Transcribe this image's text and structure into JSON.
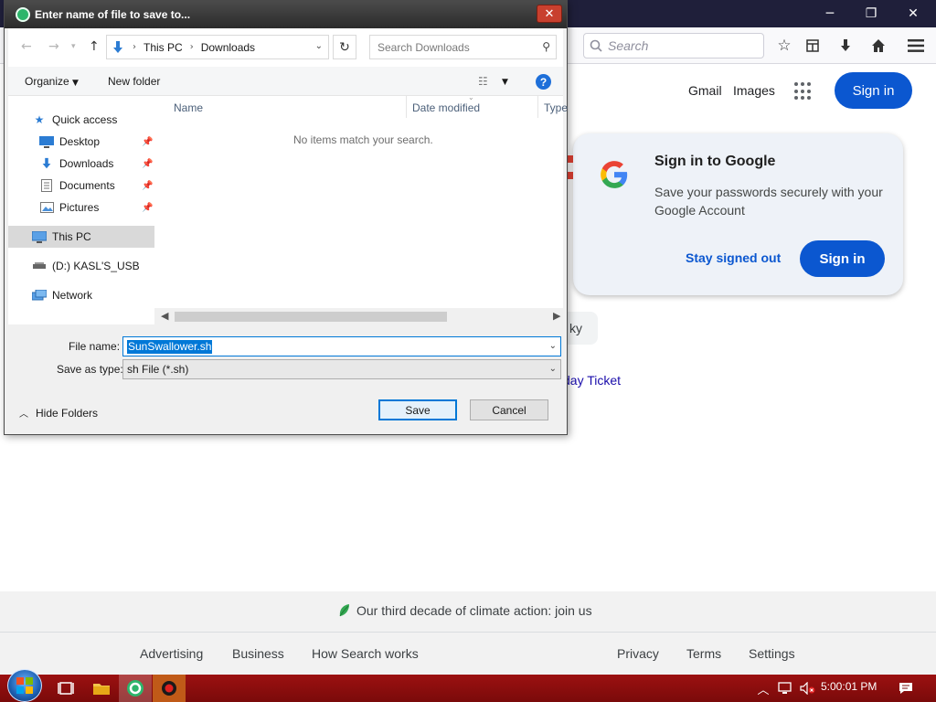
{
  "browser": {
    "search_placeholder": "Search",
    "window_controls": {
      "minimize": "─",
      "maximize": "❐",
      "close": "✕"
    }
  },
  "google": {
    "header_links": [
      "Gmail",
      "Images"
    ],
    "sign_in_label": "Sign in",
    "card": {
      "title": "Sign in to Google",
      "body": "Save your passwords securely with your Google Account",
      "stay_signed_out": "Stay signed out",
      "sign_in": "Sign in"
    },
    "partial_chip_text": "ky",
    "partial_link_text": "day Ticket",
    "footer": {
      "climate": "Our third decade of climate action: join us",
      "left_links": [
        "Advertising",
        "Business",
        "How Search works"
      ],
      "right_links": [
        "Privacy",
        "Terms",
        "Settings"
      ]
    }
  },
  "dialog": {
    "title": "Enter name of file to save to...",
    "breadcrumb": [
      "This PC",
      "Downloads"
    ],
    "search_placeholder": "Search Downloads",
    "organize": "Organize",
    "new_folder": "New folder",
    "nav": {
      "quick_access": "Quick access",
      "pinned": [
        "Desktop",
        "Downloads",
        "Documents",
        "Pictures"
      ],
      "this_pc": "This PC",
      "usb": "(D:) KASL'S_USB",
      "network": "Network"
    },
    "columns": [
      "Name",
      "Date modified",
      "Type"
    ],
    "empty_message": "No items match your search.",
    "file_name_label": "File name:",
    "file_name_value": "SunSwallower.sh",
    "save_type_label": "Save as type:",
    "save_type_value": "sh File (*.sh)",
    "hide_folders": "Hide Folders",
    "save": "Save",
    "cancel": "Cancel"
  },
  "taskbar": {
    "clock": "5:00:01 PM"
  },
  "colors": {
    "google_blue": "#0b57d0",
    "selection_blue": "#0078d7",
    "taskbar_red": "#9c1111"
  }
}
